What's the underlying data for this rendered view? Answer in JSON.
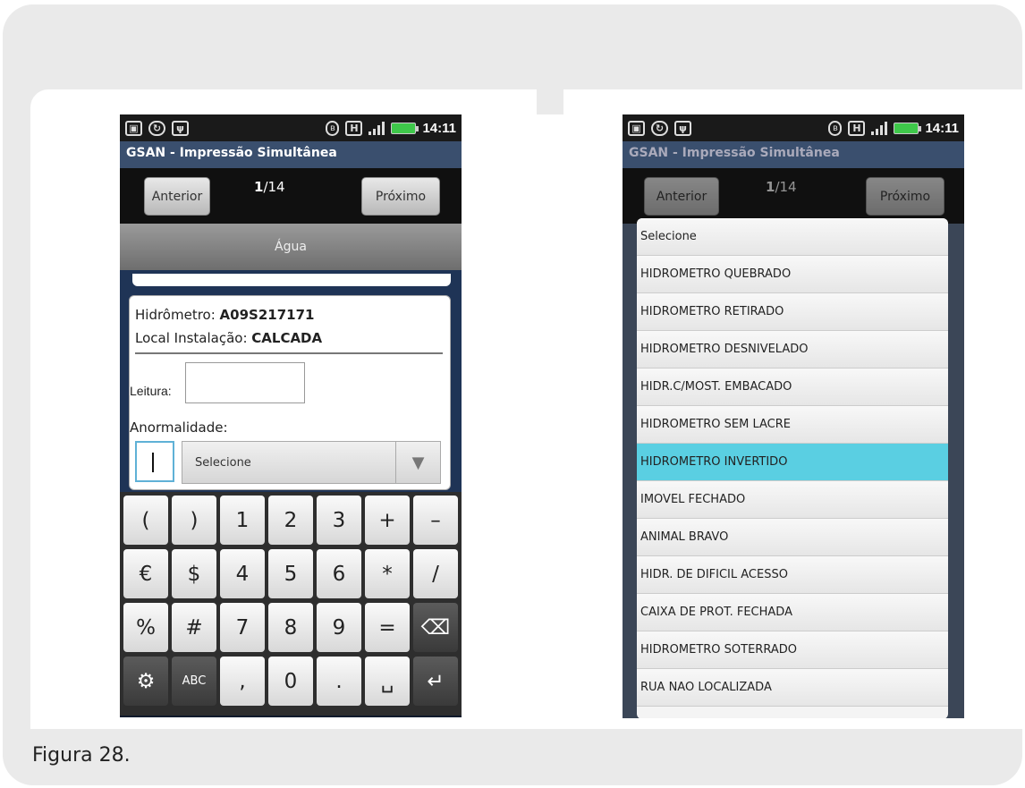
{
  "caption": "Figura 28.",
  "status": {
    "time": "14:11",
    "bluetooth": "bluetooth-icon",
    "signal": "signal-icon",
    "battery": "battery-icon"
  },
  "left": {
    "app_title": "GSAN - Impressão Simultânea",
    "prev_label": "Anterior",
    "next_label": "Próximo",
    "counter_current": "1",
    "counter_total": "/14",
    "section": "Água",
    "hidrometro_label": "Hidrômetro: ",
    "hidrometro_value": "A09S217171",
    "local_label": "Local Instalação: ",
    "local_value": "CALCADA",
    "leitura_label": "Leitura:",
    "leitura_value": "",
    "anormalidade_label": "Anormalidade:",
    "select_value": "Selecione",
    "keyboard": [
      [
        "(",
        ")",
        "1",
        "2",
        "3",
        "+",
        "–"
      ],
      [
        "€",
        "$",
        "4",
        "5",
        "6",
        "*",
        "/"
      ],
      [
        "%",
        "#",
        "7",
        "8",
        "9",
        "=",
        "⌫"
      ],
      [
        "⚙",
        "ABC",
        ",",
        "0",
        ".",
        "␣",
        "↵"
      ]
    ]
  },
  "right": {
    "app_title": "GSAN - Impressão Simultânea",
    "prev_label": "Anterior",
    "next_label": "Próximo",
    "counter_current": "1",
    "counter_total": "/14",
    "options": [
      "Selecione",
      "HIDROMETRO QUEBRADO",
      "HIDROMETRO RETIRADO",
      "HIDROMETRO DESNIVELADO",
      "HIDR.C/MOST. EMBACADO",
      "HIDROMETRO SEM LACRE",
      "HIDROMETRO INVERTIDO",
      "IMOVEL FECHADO",
      "ANIMAL BRAVO",
      "HIDR. DE DIFICIL ACESSO",
      "CAIXA DE PROT. FECHADA",
      "HIDROMETRO SOTERRADO",
      "RUA NAO LOCALIZADA"
    ],
    "selected_option": "HIDROMETRO INVERTIDO"
  },
  "colors": {
    "highlight": "#5acfe2",
    "title_bar": "#3a4f6e",
    "frame_bg": "#eaeaea"
  }
}
